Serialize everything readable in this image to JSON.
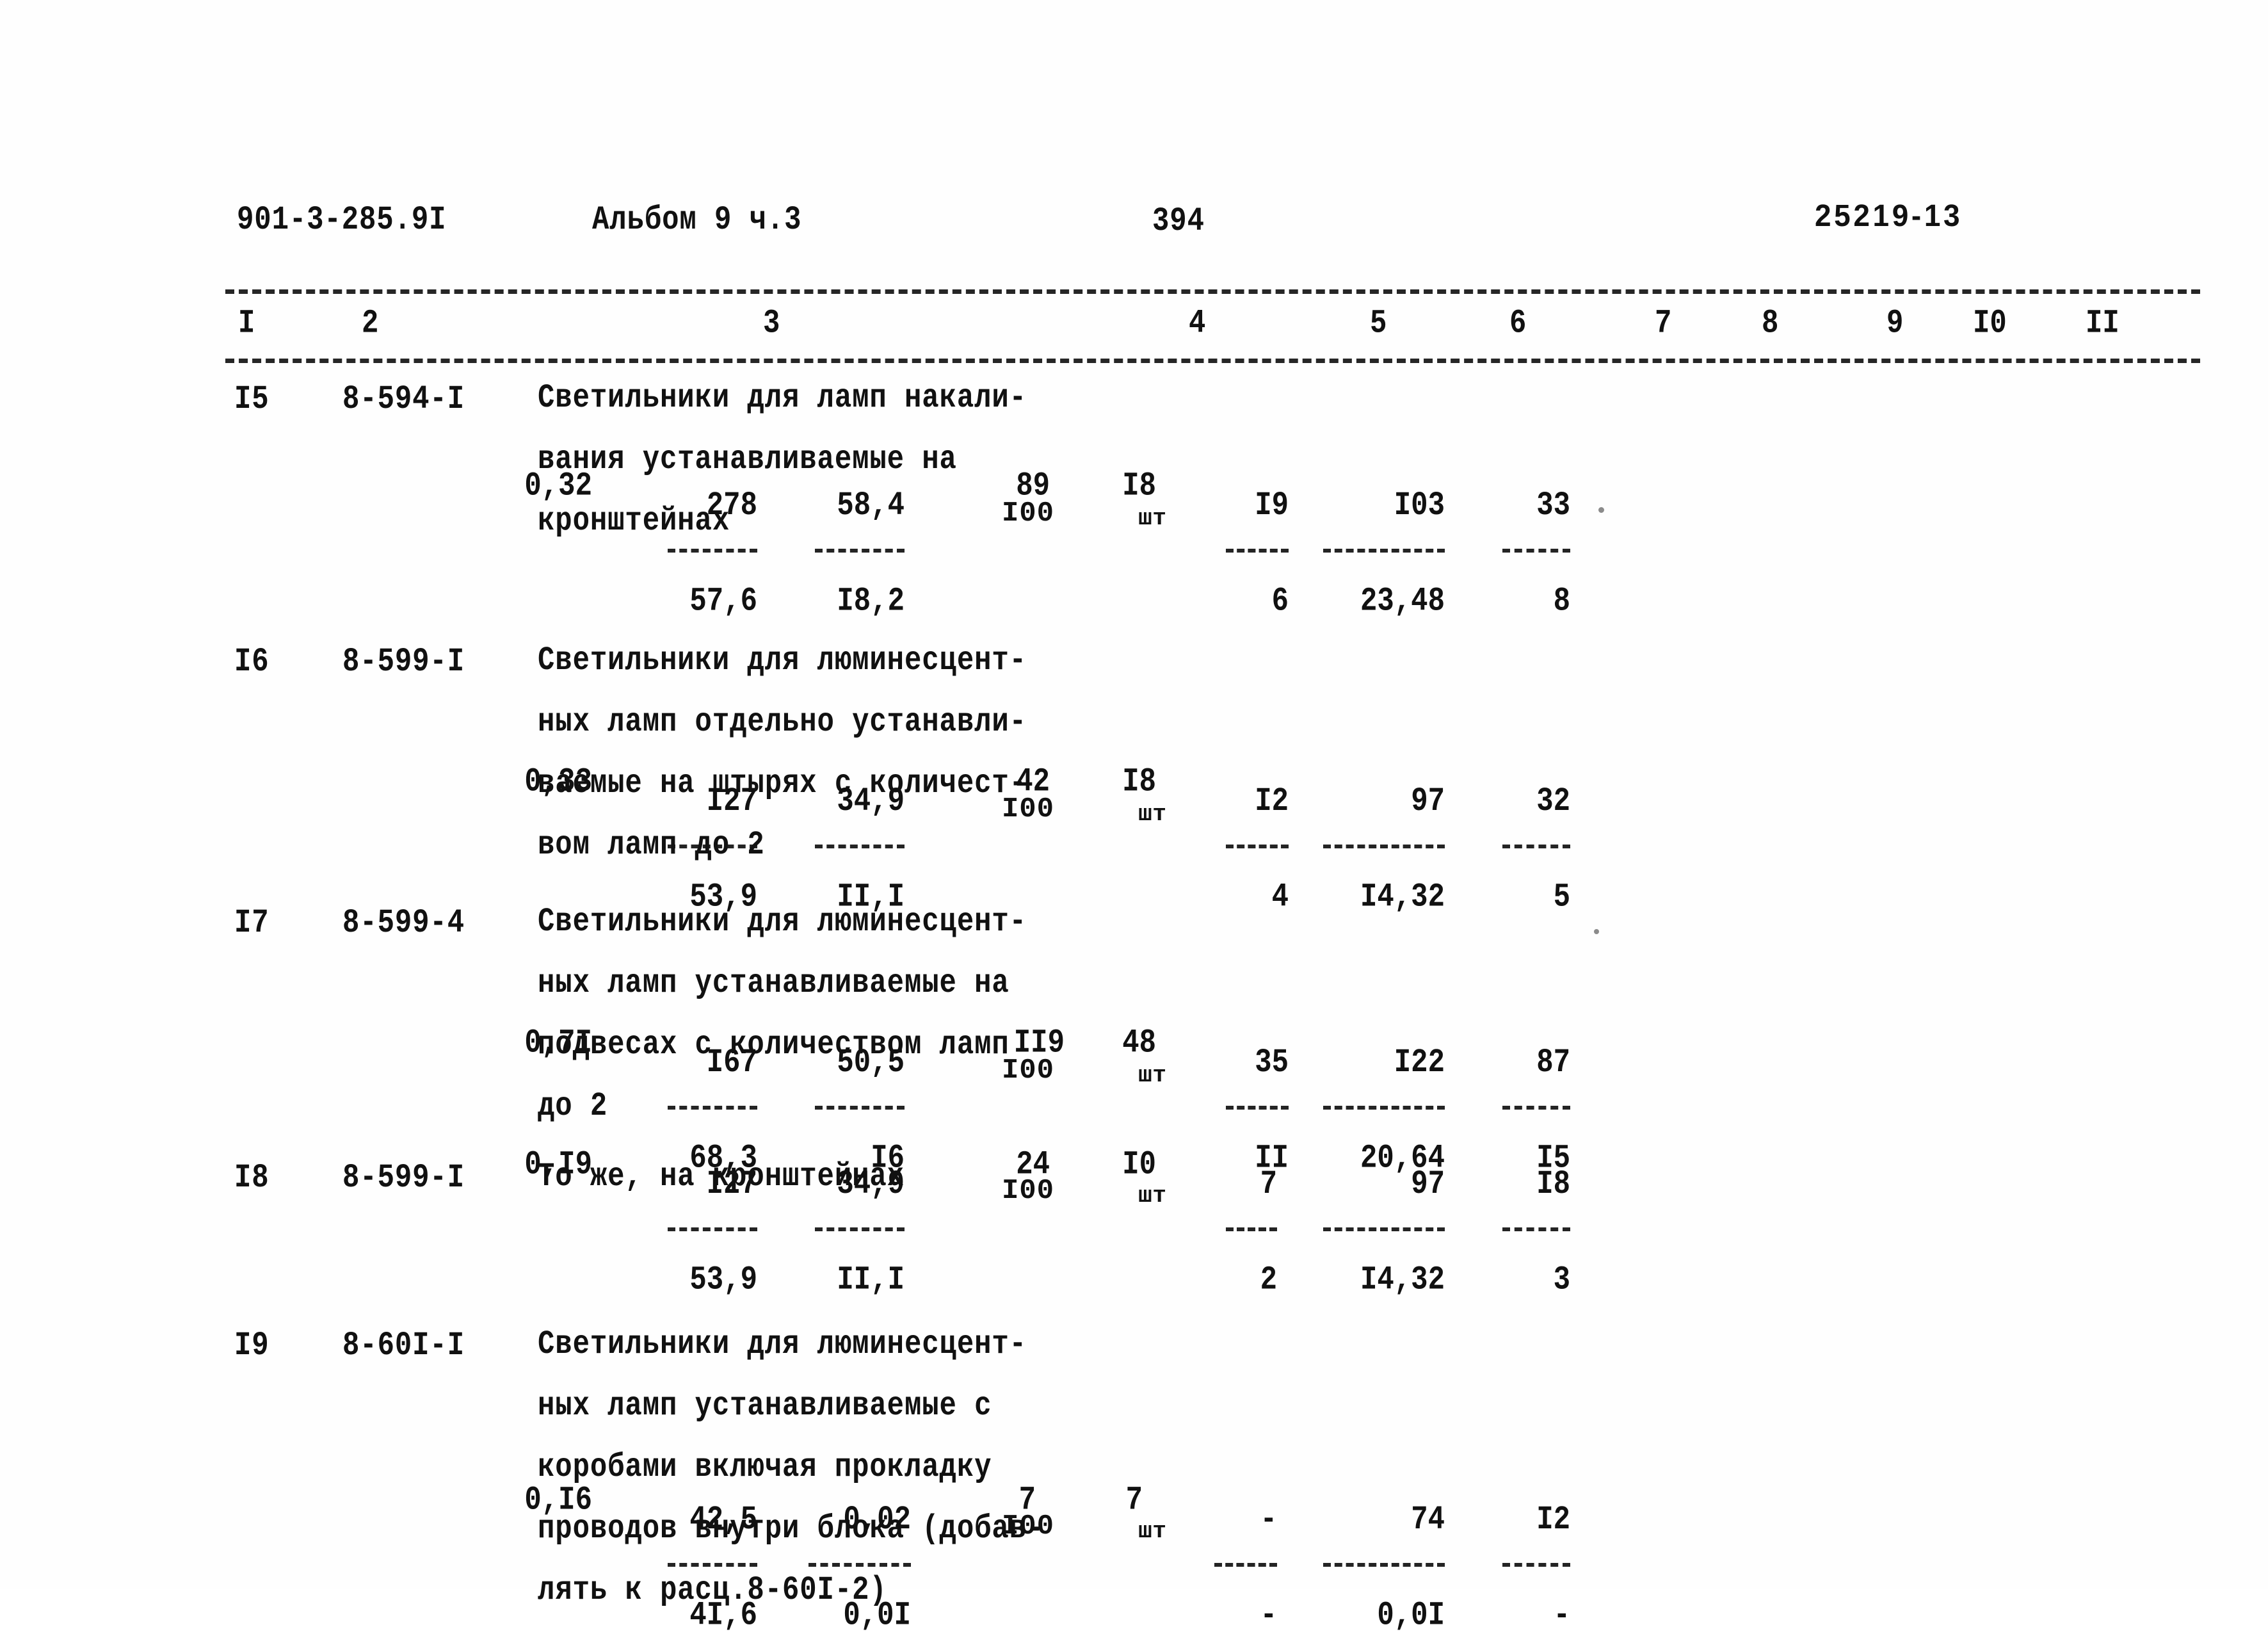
{
  "header": {
    "doc_code": "901-3-285.9I",
    "album": "Альбом 9 ч.3",
    "page_number": "394",
    "archive_stamp": "25219-13"
  },
  "table": {
    "column_headers": [
      "I",
      "2",
      "3",
      "4",
      "5",
      "6",
      "7",
      "8",
      "9",
      "I0",
      "II"
    ],
    "rows": [
      {
        "num": "I5",
        "code": "8-594-I",
        "desc_lines": [
          "Светильники для ламп накали-",
          "вания устанавливаемые на",
          "кронштейнах"
        ],
        "unit_qty": "I00",
        "unit_word": "шт",
        "c4": "0,32",
        "c5_top": "278",
        "c5_bot": "57,6",
        "c6_top": "58,4",
        "c6_bot": "I8,2",
        "c7": "89",
        "c8": "I8",
        "c9_top": "I9",
        "c9_bot": "6",
        "c10_top": "I03",
        "c10_bot": "23,48",
        "c11_top": "33",
        "c11_bot": "8"
      },
      {
        "num": "I6",
        "code": "8-599-I",
        "desc_lines": [
          "Светильники для люминесцент-",
          "ных ламп отдельно устанавли-",
          "ваемые на штырях с количест-",
          "вом ламп до 2"
        ],
        "unit_qty": "I00",
        "unit_word": "шт",
        "c4": "0,33",
        "c5_top": "I27",
        "c5_bot": "53,9",
        "c6_top": "34,9",
        "c6_bot": "II,I",
        "c7": "42",
        "c8": "I8",
        "c9_top": "I2",
        "c9_bot": "4",
        "c10_top": "97",
        "c10_bot": "I4,32",
        "c11_top": "32",
        "c11_bot": "5"
      },
      {
        "num": "I7",
        "code": "8-599-4",
        "desc_lines": [
          "Светильники для люминесцент-",
          "ных ламп устанавливаемые на",
          "подвесах с количеством ламп",
          "до 2"
        ],
        "unit_qty": "I00",
        "unit_word": "шт",
        "c4": "0,7I",
        "c5_top": "I67",
        "c5_bot": "68,3",
        "c6_top": "50,5",
        "c6_bot": "I6",
        "c7": "II9",
        "c8": "48",
        "c9_top": "35",
        "c9_bot": "II",
        "c10_top": "I22",
        "c10_bot": "20,64",
        "c11_top": "87",
        "c11_bot": "I5"
      },
      {
        "num": "I8",
        "code": "8-599-I",
        "desc_lines": [
          "То же, на кронштейнах"
        ],
        "unit_qty": "I00",
        "unit_word": "шт",
        "c4": "0,I9",
        "c5_top": "I27",
        "c5_bot": "53,9",
        "c6_top": "34,9",
        "c6_bot": "II,I",
        "c7": "24",
        "c8": "I0",
        "c9_top": "7",
        "c9_bot": "2",
        "c10_top": "97",
        "c10_bot": "I4,32",
        "c11_top": "I8",
        "c11_bot": "3"
      },
      {
        "num": "I9",
        "code": "8-60I-I",
        "desc_lines": [
          "Светильники для люминесцент-",
          "ных ламп устанавливаемые с",
          "коробами включая прокладку",
          "проводов внутри блока (добав-",
          "лять к расц.8-60I-2)"
        ],
        "unit_qty": "I00",
        "unit_word": "шт",
        "c4": "0,I6",
        "c5_top": "42,5",
        "c5_bot": "4I,6",
        "c6_top": "0,02",
        "c6_bot": "0,0I",
        "c7": "7",
        "c8": "7",
        "c9_top": "-",
        "c9_bot": "-",
        "c10_top": "74",
        "c10_bot": "0,0I",
        "c11_top": "I2",
        "c11_bot": "-"
      }
    ]
  }
}
